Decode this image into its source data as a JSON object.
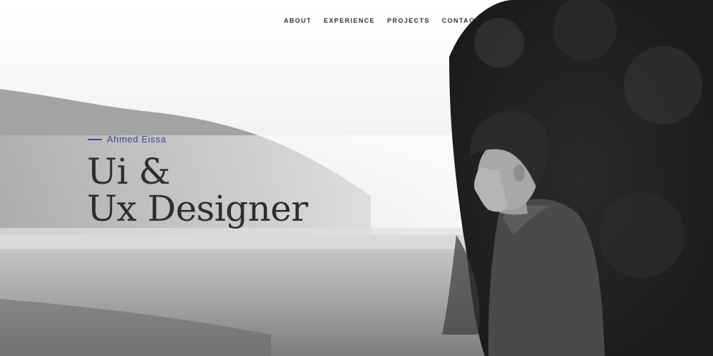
{
  "nav": {
    "items": [
      {
        "label": "ABOUT"
      },
      {
        "label": "EXPERIENCE"
      },
      {
        "label": "PROJECTS"
      },
      {
        "label": "CONTACT"
      }
    ]
  },
  "hero": {
    "eyebrow_name": "Ahmed Eissa",
    "headline_line1": "Ui &",
    "headline_line2": "Ux Designer",
    "accent_color": "#3d46a6",
    "background_image": "black-and-white photo of young man by misty lake with trees"
  }
}
